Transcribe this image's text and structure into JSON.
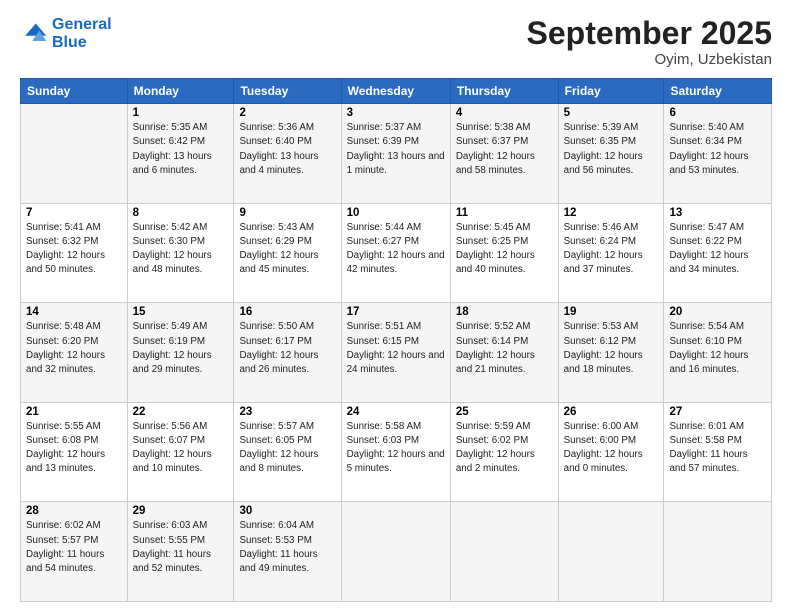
{
  "header": {
    "logo_line1": "General",
    "logo_line2": "Blue",
    "month": "September 2025",
    "location": "Oyim, Uzbekistan"
  },
  "weekdays": [
    "Sunday",
    "Monday",
    "Tuesday",
    "Wednesday",
    "Thursday",
    "Friday",
    "Saturday"
  ],
  "weeks": [
    [
      {
        "day": "",
        "sunrise": "",
        "sunset": "",
        "daylight": ""
      },
      {
        "day": "1",
        "sunrise": "Sunrise: 5:35 AM",
        "sunset": "Sunset: 6:42 PM",
        "daylight": "Daylight: 13 hours and 6 minutes."
      },
      {
        "day": "2",
        "sunrise": "Sunrise: 5:36 AM",
        "sunset": "Sunset: 6:40 PM",
        "daylight": "Daylight: 13 hours and 4 minutes."
      },
      {
        "day": "3",
        "sunrise": "Sunrise: 5:37 AM",
        "sunset": "Sunset: 6:39 PM",
        "daylight": "Daylight: 13 hours and 1 minute."
      },
      {
        "day": "4",
        "sunrise": "Sunrise: 5:38 AM",
        "sunset": "Sunset: 6:37 PM",
        "daylight": "Daylight: 12 hours and 58 minutes."
      },
      {
        "day": "5",
        "sunrise": "Sunrise: 5:39 AM",
        "sunset": "Sunset: 6:35 PM",
        "daylight": "Daylight: 12 hours and 56 minutes."
      },
      {
        "day": "6",
        "sunrise": "Sunrise: 5:40 AM",
        "sunset": "Sunset: 6:34 PM",
        "daylight": "Daylight: 12 hours and 53 minutes."
      }
    ],
    [
      {
        "day": "7",
        "sunrise": "Sunrise: 5:41 AM",
        "sunset": "Sunset: 6:32 PM",
        "daylight": "Daylight: 12 hours and 50 minutes."
      },
      {
        "day": "8",
        "sunrise": "Sunrise: 5:42 AM",
        "sunset": "Sunset: 6:30 PM",
        "daylight": "Daylight: 12 hours and 48 minutes."
      },
      {
        "day": "9",
        "sunrise": "Sunrise: 5:43 AM",
        "sunset": "Sunset: 6:29 PM",
        "daylight": "Daylight: 12 hours and 45 minutes."
      },
      {
        "day": "10",
        "sunrise": "Sunrise: 5:44 AM",
        "sunset": "Sunset: 6:27 PM",
        "daylight": "Daylight: 12 hours and 42 minutes."
      },
      {
        "day": "11",
        "sunrise": "Sunrise: 5:45 AM",
        "sunset": "Sunset: 6:25 PM",
        "daylight": "Daylight: 12 hours and 40 minutes."
      },
      {
        "day": "12",
        "sunrise": "Sunrise: 5:46 AM",
        "sunset": "Sunset: 6:24 PM",
        "daylight": "Daylight: 12 hours and 37 minutes."
      },
      {
        "day": "13",
        "sunrise": "Sunrise: 5:47 AM",
        "sunset": "Sunset: 6:22 PM",
        "daylight": "Daylight: 12 hours and 34 minutes."
      }
    ],
    [
      {
        "day": "14",
        "sunrise": "Sunrise: 5:48 AM",
        "sunset": "Sunset: 6:20 PM",
        "daylight": "Daylight: 12 hours and 32 minutes."
      },
      {
        "day": "15",
        "sunrise": "Sunrise: 5:49 AM",
        "sunset": "Sunset: 6:19 PM",
        "daylight": "Daylight: 12 hours and 29 minutes."
      },
      {
        "day": "16",
        "sunrise": "Sunrise: 5:50 AM",
        "sunset": "Sunset: 6:17 PM",
        "daylight": "Daylight: 12 hours and 26 minutes."
      },
      {
        "day": "17",
        "sunrise": "Sunrise: 5:51 AM",
        "sunset": "Sunset: 6:15 PM",
        "daylight": "Daylight: 12 hours and 24 minutes."
      },
      {
        "day": "18",
        "sunrise": "Sunrise: 5:52 AM",
        "sunset": "Sunset: 6:14 PM",
        "daylight": "Daylight: 12 hours and 21 minutes."
      },
      {
        "day": "19",
        "sunrise": "Sunrise: 5:53 AM",
        "sunset": "Sunset: 6:12 PM",
        "daylight": "Daylight: 12 hours and 18 minutes."
      },
      {
        "day": "20",
        "sunrise": "Sunrise: 5:54 AM",
        "sunset": "Sunset: 6:10 PM",
        "daylight": "Daylight: 12 hours and 16 minutes."
      }
    ],
    [
      {
        "day": "21",
        "sunrise": "Sunrise: 5:55 AM",
        "sunset": "Sunset: 6:08 PM",
        "daylight": "Daylight: 12 hours and 13 minutes."
      },
      {
        "day": "22",
        "sunrise": "Sunrise: 5:56 AM",
        "sunset": "Sunset: 6:07 PM",
        "daylight": "Daylight: 12 hours and 10 minutes."
      },
      {
        "day": "23",
        "sunrise": "Sunrise: 5:57 AM",
        "sunset": "Sunset: 6:05 PM",
        "daylight": "Daylight: 12 hours and 8 minutes."
      },
      {
        "day": "24",
        "sunrise": "Sunrise: 5:58 AM",
        "sunset": "Sunset: 6:03 PM",
        "daylight": "Daylight: 12 hours and 5 minutes."
      },
      {
        "day": "25",
        "sunrise": "Sunrise: 5:59 AM",
        "sunset": "Sunset: 6:02 PM",
        "daylight": "Daylight: 12 hours and 2 minutes."
      },
      {
        "day": "26",
        "sunrise": "Sunrise: 6:00 AM",
        "sunset": "Sunset: 6:00 PM",
        "daylight": "Daylight: 12 hours and 0 minutes."
      },
      {
        "day": "27",
        "sunrise": "Sunrise: 6:01 AM",
        "sunset": "Sunset: 5:58 PM",
        "daylight": "Daylight: 11 hours and 57 minutes."
      }
    ],
    [
      {
        "day": "28",
        "sunrise": "Sunrise: 6:02 AM",
        "sunset": "Sunset: 5:57 PM",
        "daylight": "Daylight: 11 hours and 54 minutes."
      },
      {
        "day": "29",
        "sunrise": "Sunrise: 6:03 AM",
        "sunset": "Sunset: 5:55 PM",
        "daylight": "Daylight: 11 hours and 52 minutes."
      },
      {
        "day": "30",
        "sunrise": "Sunrise: 6:04 AM",
        "sunset": "Sunset: 5:53 PM",
        "daylight": "Daylight: 11 hours and 49 minutes."
      },
      {
        "day": "",
        "sunrise": "",
        "sunset": "",
        "daylight": ""
      },
      {
        "day": "",
        "sunrise": "",
        "sunset": "",
        "daylight": ""
      },
      {
        "day": "",
        "sunrise": "",
        "sunset": "",
        "daylight": ""
      },
      {
        "day": "",
        "sunrise": "",
        "sunset": "",
        "daylight": ""
      }
    ]
  ]
}
